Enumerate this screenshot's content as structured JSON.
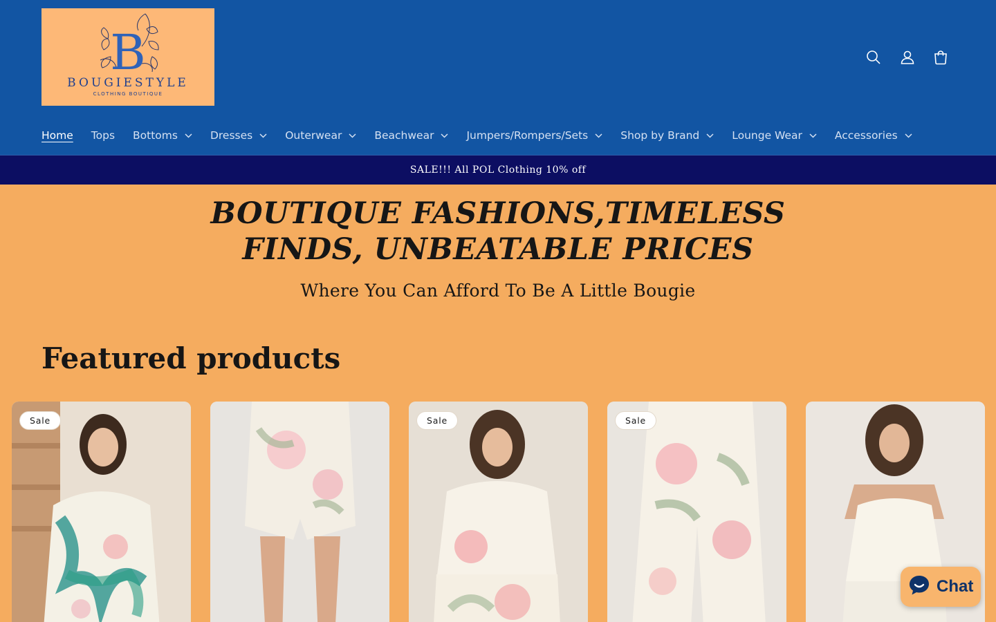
{
  "brand": {
    "logo_letter": "B",
    "logo_name": "BOUGIESTYLE",
    "logo_tagline": "CLOTHING BOUTIQUE"
  },
  "header_icons": [
    {
      "name": "search-icon"
    },
    {
      "name": "account-icon"
    },
    {
      "name": "cart-icon"
    }
  ],
  "nav": {
    "items": [
      {
        "label": "Home",
        "active": true,
        "has_dropdown": false
      },
      {
        "label": "Tops",
        "has_dropdown": false
      },
      {
        "label": "Bottoms",
        "has_dropdown": true
      },
      {
        "label": "Dresses",
        "has_dropdown": true
      },
      {
        "label": "Outerwear",
        "has_dropdown": true
      },
      {
        "label": "Beachwear",
        "has_dropdown": true
      },
      {
        "label": "Jumpers/Rompers/Sets",
        "has_dropdown": true
      },
      {
        "label": "Shop by Brand",
        "has_dropdown": true
      },
      {
        "label": "Lounge Wear",
        "has_dropdown": true
      },
      {
        "label": "Accessories",
        "has_dropdown": true
      }
    ]
  },
  "announcement": {
    "text": "SALE!!! All POL Clothing 10% off"
  },
  "hero": {
    "title_line1": "BOUTIQUE FASHIONS,TIMELESS",
    "title_line2": "FINDS, UNBEATABLE PRICES",
    "subtitle": "Where You Can Afford To Be A Little Bougie"
  },
  "featured": {
    "heading": "Featured products",
    "products": [
      {
        "badge": "Sale",
        "on_sale": true
      },
      {
        "badge": "",
        "on_sale": false
      },
      {
        "badge": "Sale",
        "on_sale": true
      },
      {
        "badge": "Sale",
        "on_sale": true
      },
      {
        "badge": "",
        "on_sale": false
      }
    ]
  },
  "chat": {
    "label": "Chat"
  },
  "colors": {
    "header_bg": "#1255A3",
    "announcement_bg": "#0C0E62",
    "page_bg": "#F5AC5F",
    "logo_bg": "#FDB877",
    "chat_text": "#0E3268"
  }
}
